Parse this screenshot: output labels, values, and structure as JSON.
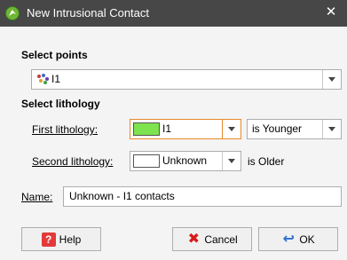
{
  "window": {
    "title": "New Intrusional Contact",
    "close_glyph": "✕"
  },
  "select_points": {
    "section_title": "Select points",
    "section_title_mnemonic": "e",
    "selected_value": "I1",
    "icon": "points-icon"
  },
  "select_lithology": {
    "section_title": "Select lithology",
    "first": {
      "label": "First lithology:",
      "label_mnemonic": "F",
      "value": "I1",
      "swatch_color": "#7de34f",
      "relation_value": "is Younger"
    },
    "second": {
      "label": "Second lithology:",
      "label_mnemonic": "S",
      "value": "Unknown",
      "swatch_color": "#ffffff",
      "relation_text": "is Older"
    }
  },
  "name_field": {
    "label": "Name:",
    "label_mnemonic": "N",
    "value": "Unknown - I1 contacts"
  },
  "buttons": {
    "help": {
      "label": "Help",
      "mnemonic": "H",
      "icon": "help-icon"
    },
    "cancel": {
      "label": "Cancel",
      "mnemonic": "C",
      "icon": "cancel-icon"
    },
    "ok": {
      "label": "OK",
      "mnemonic": "O",
      "icon": "ok-icon"
    }
  },
  "colors": {
    "titlebar": "#474747",
    "focus_border": "#e6892a",
    "first_swatch": "#7de34f"
  }
}
